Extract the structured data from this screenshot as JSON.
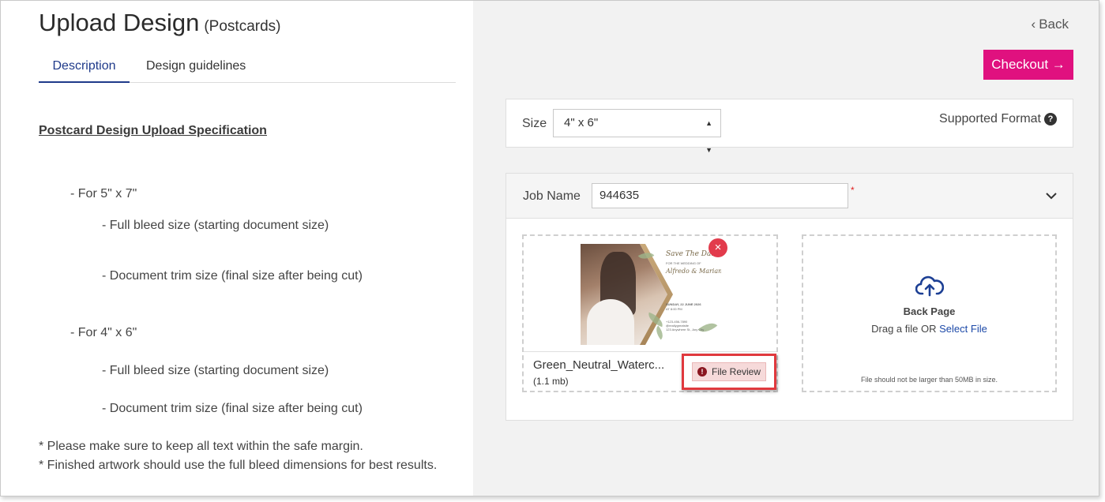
{
  "page": {
    "title": "Upload Design",
    "subtitle": "(Postcards)"
  },
  "tabs": [
    {
      "label": "Description",
      "active": true
    },
    {
      "label": "Design guidelines",
      "active": false
    }
  ],
  "description": {
    "heading": "Postcard Design Upload Specification",
    "groups": [
      {
        "label": "- For 5\" x 7\"",
        "items": [
          "- Full bleed size (starting document size)",
          "- Document trim size (final size after being cut)"
        ]
      },
      {
        "label": "- For 4\" x 6\"",
        "items": [
          "- Full bleed size (starting document size)",
          "- Document trim size (final size after being cut)"
        ]
      }
    ],
    "notes": [
      "* Please make sure to keep all text within the safe margin.",
      "* Finished artwork should use the full bleed dimensions for best results."
    ]
  },
  "nav": {
    "back_label": "Back",
    "checkout_label": "Checkout"
  },
  "size": {
    "label": "Size",
    "selected": "4\" x 6\"",
    "supported_format_label": "Supported Format",
    "help_icon_text": "?"
  },
  "job": {
    "label": "Job Name",
    "value": "944635",
    "required_mark": "*"
  },
  "front_upload": {
    "file_name": "Green_Neutral_Waterc...",
    "file_size": "(1.1 mb)",
    "review_label": "File Review",
    "review_icon_text": "!",
    "remove_icon": "×",
    "preview": {
      "script_title": "Save The Date",
      "line1": "FOR THE WEDDING OF",
      "names": "Alfredo & Mariana",
      "date": "SUNDAY, 22 JUNE 2026",
      "time": "AT 8:00 PM",
      "phone": "+123-456-7890",
      "handle": "@reallygreatsite",
      "address": "123 Anywhere St., Any City"
    }
  },
  "back_upload": {
    "title": "Back Page",
    "instruction_prefix": "Drag a file OR",
    "select_link": "Select File",
    "limit_note": "File should not be larger than 50MB in size."
  },
  "colors": {
    "accent": "#e0117f",
    "tab_active": "#1f3a8a",
    "link": "#1c49a8",
    "remove": "#e23b4c",
    "review_highlight": "#e0393e"
  }
}
